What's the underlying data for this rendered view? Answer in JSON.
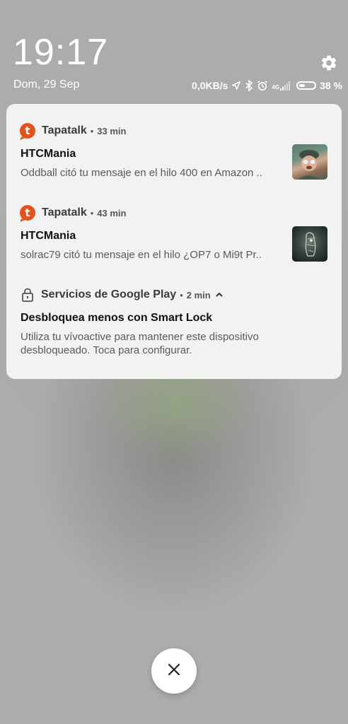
{
  "status": {
    "time": "19:17",
    "date": "Dom, 29 Sep",
    "net_speed": "0,0KB/s",
    "network_type": "4G",
    "battery_percent_label": "38 %",
    "battery_level": 0.38,
    "icons": [
      "location-icon",
      "bluetooth-icon",
      "alarm-icon",
      "signal-icon",
      "battery-icon"
    ]
  },
  "settings": {
    "icon": "gear-icon"
  },
  "notifications": [
    {
      "app": "Tapatalk",
      "separator": "•",
      "time": "33 min",
      "title": "HTCMania",
      "text": "Oddball citó tu mensaje en el hilo 400 en Amazon ..",
      "icon": "tapatalk-icon",
      "app_icon_letter": "t",
      "thumbnail": "user-avatar-thumbnail"
    },
    {
      "app": "Tapatalk",
      "separator": "•",
      "time": "43 min",
      "title": "HTCMania",
      "text": "solrac79 citó tu mensaje en el hilo ¿OP7 o Mi9t Pr..",
      "icon": "tapatalk-icon",
      "app_icon_letter": "t",
      "thumbnail": "user-avatar-thumbnail"
    },
    {
      "app": "Servicios de Google Play",
      "separator": "•",
      "time": "2 min",
      "title": "Desbloquea menos con Smart Lock",
      "text_line1": "Utiliza tu vívoactive para mantener este dispositivo",
      "text_line2": "desbloqueado. Toca para configurar.",
      "icon": "lock-icon",
      "expand_icon": "chevron-up-icon"
    }
  ],
  "close_button": {
    "icon": "close-icon"
  },
  "colors": {
    "background": "#acacac",
    "card": "#f2f2f2",
    "tapatalk_accent": "#e0531e"
  }
}
